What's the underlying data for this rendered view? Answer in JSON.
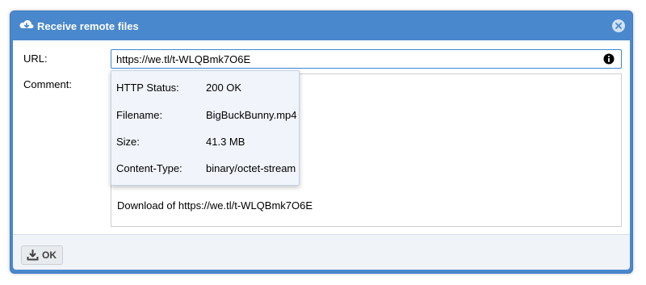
{
  "dialog": {
    "title": "Receive remote files",
    "title_icon": "cloud-download-icon",
    "close_icon": "close-icon"
  },
  "form": {
    "url_label": "URL:",
    "url_value": "https://we.tl/t-WLQBmk7O6E",
    "url_icon": "info-icon",
    "comment_label": "Comment:",
    "comment_value": "Download of https://we.tl/t-WLQBmk7O6E"
  },
  "tooltip": {
    "rows": [
      {
        "key": "HTTP Status:",
        "value": "200 OK"
      },
      {
        "key": "Filename:",
        "value": "BigBuckBunny.mp4"
      },
      {
        "key": "Size:",
        "value": "41.3 MB"
      },
      {
        "key": "Content-Type:",
        "value": "binary/octet-stream"
      }
    ]
  },
  "footer": {
    "ok_label": "OK",
    "ok_icon": "download-icon"
  },
  "colors": {
    "titlebar": "#4a88cd",
    "input_focus_border": "#3a87d6",
    "tooltip_bg": "#f1f5fb"
  }
}
